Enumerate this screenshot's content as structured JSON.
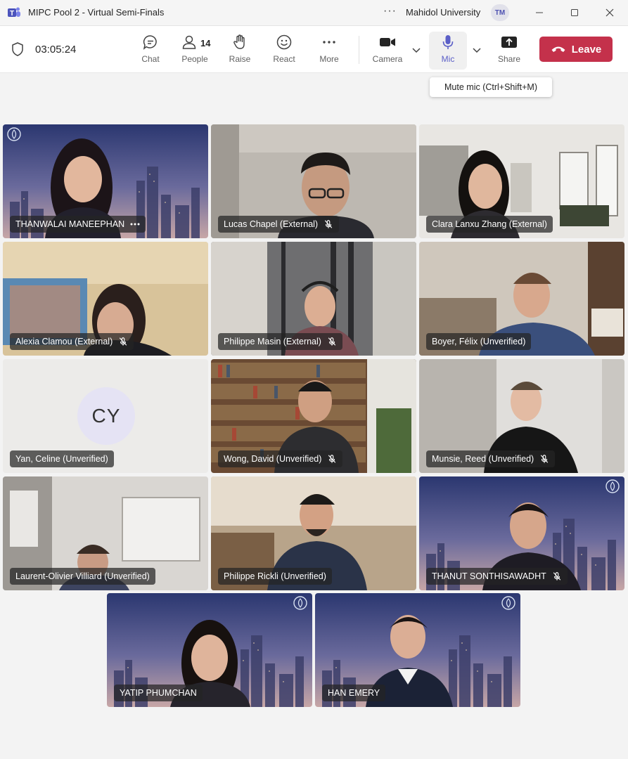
{
  "window": {
    "title": "MIPC Pool 2 - Virtual Semi-Finals",
    "org": "Mahidol University",
    "avatar_initials": "TM",
    "more_icon": "more-horizontal-icon",
    "minimize_icon": "minimize-icon",
    "maximize_icon": "maximize-icon",
    "close_icon": "close-icon"
  },
  "toolbar": {
    "timer": "03:05:24",
    "chat": "Chat",
    "people": "People",
    "people_count": "14",
    "raise": "Raise",
    "react": "React",
    "more": "More",
    "camera": "Camera",
    "mic": "Mic",
    "share": "Share",
    "leave": "Leave"
  },
  "tooltip": "Mute mic (Ctrl+Shift+M)",
  "colors": {
    "leave_red": "#c4314b",
    "accent": "#5b5fc7"
  },
  "participants": [
    {
      "name": "THANWALAI MANEEPHAN",
      "muted": false,
      "more": true
    },
    {
      "name": "Lucas Chapel (External)",
      "muted": true
    },
    {
      "name": "Clara Lanxu Zhang (External)",
      "muted": false
    },
    {
      "name": "Alexia Clamou (External)",
      "muted": true
    },
    {
      "name": "Philippe Masin (External)",
      "muted": true
    },
    {
      "name": "Boyer, Félix (Unverified)",
      "muted": false
    },
    {
      "name": "Yan, Celine (Unverified)",
      "muted": false,
      "initials": "CY"
    },
    {
      "name": "Wong, David (Unverified)",
      "muted": true
    },
    {
      "name": "Munsie, Reed (Unverified)",
      "muted": true
    },
    {
      "name": "Laurent-Olivier Villiard (Unverified)",
      "muted": false
    },
    {
      "name": "Philippe Rickli (Unverified)",
      "muted": false
    },
    {
      "name": "THANUT SONTHISAWADHT",
      "muted": true
    },
    {
      "name": "YATIP PHUMCHAN",
      "muted": false
    },
    {
      "name": "HAN EMERY",
      "muted": false
    }
  ]
}
